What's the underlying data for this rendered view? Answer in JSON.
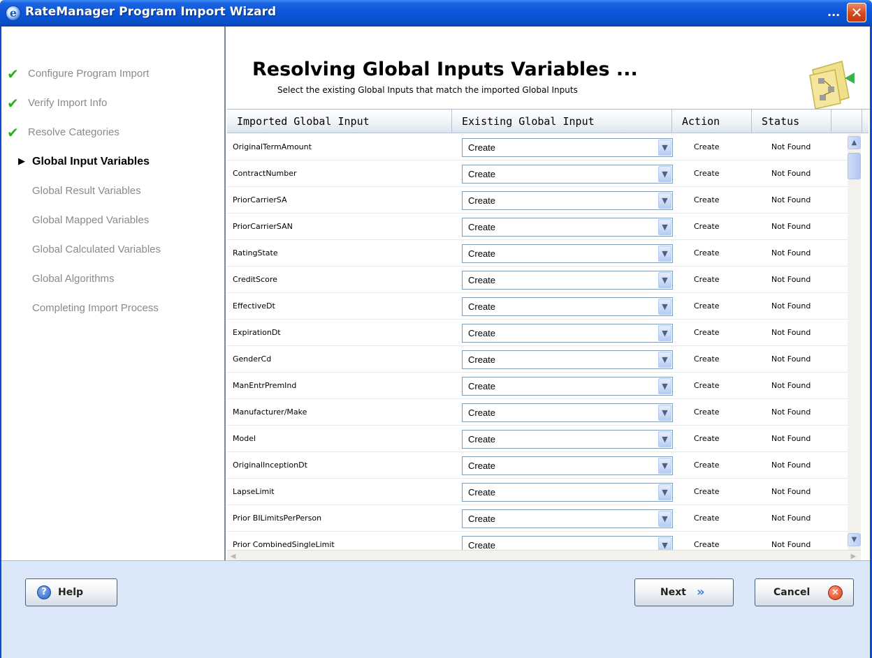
{
  "window": {
    "title": "RateManager Program Import Wizard",
    "ellipsis": "...",
    "close_glyph": "✕"
  },
  "sidebar": {
    "items": [
      {
        "label": "Configure Program Import",
        "state": "done"
      },
      {
        "label": "Verify Import Info",
        "state": "done"
      },
      {
        "label": "Resolve Categories",
        "state": "done"
      },
      {
        "label": "Global Input Variables",
        "state": "current"
      },
      {
        "label": "Global Result Variables",
        "state": "pending"
      },
      {
        "label": "Global Mapped Variables",
        "state": "pending"
      },
      {
        "label": "Global Calculated Variables",
        "state": "pending"
      },
      {
        "label": "Global Algorithms",
        "state": "pending"
      },
      {
        "label": "Completing Import Process",
        "state": "pending"
      }
    ]
  },
  "header": {
    "heading": "Resolving Global Inputs Variables ...",
    "subheading": "Select the existing Global Inputs that match the imported Global Inputs"
  },
  "grid": {
    "columns": [
      "Imported Global Input",
      "Existing Global Input",
      "Action",
      "Status"
    ],
    "rows": [
      {
        "imported": "OriginalTermAmount",
        "existing": "Create",
        "action": "Create",
        "status": "Not Found"
      },
      {
        "imported": "ContractNumber",
        "existing": "Create",
        "action": "Create",
        "status": "Not Found"
      },
      {
        "imported": "PriorCarrierSA",
        "existing": "Create",
        "action": "Create",
        "status": "Not Found"
      },
      {
        "imported": "PriorCarrierSAN",
        "existing": "Create",
        "action": "Create",
        "status": "Not Found"
      },
      {
        "imported": "RatingState",
        "existing": "Create",
        "action": "Create",
        "status": "Not Found"
      },
      {
        "imported": "CreditScore",
        "existing": "Create",
        "action": "Create",
        "status": "Not Found"
      },
      {
        "imported": "EffectiveDt",
        "existing": "Create",
        "action": "Create",
        "status": "Not Found"
      },
      {
        "imported": "ExpirationDt",
        "existing": "Create",
        "action": "Create",
        "status": "Not Found"
      },
      {
        "imported": "GenderCd",
        "existing": "Create",
        "action": "Create",
        "status": "Not Found"
      },
      {
        "imported": "ManEntrPremInd",
        "existing": "Create",
        "action": "Create",
        "status": "Not Found"
      },
      {
        "imported": "Manufacturer/Make",
        "existing": "Create",
        "action": "Create",
        "status": "Not Found"
      },
      {
        "imported": "Model",
        "existing": "Create",
        "action": "Create",
        "status": "Not Found"
      },
      {
        "imported": "OriginalInceptionDt",
        "existing": "Create",
        "action": "Create",
        "status": "Not Found"
      },
      {
        "imported": "LapseLimit",
        "existing": "Create",
        "action": "Create",
        "status": "Not Found"
      },
      {
        "imported": "Prior BILimitsPerPerson",
        "existing": "Create",
        "action": "Create",
        "status": "Not Found"
      },
      {
        "imported": "Prior CombinedSingleLimit",
        "existing": "Create",
        "action": "Create",
        "status": "Not Found"
      }
    ]
  },
  "footer": {
    "help_label": "Help",
    "next_label": "Next",
    "cancel_label": "Cancel"
  },
  "icons": {
    "check": "check-icon",
    "current_arrow": "triangle-right-icon",
    "dropdown": "chevron-down-icon",
    "help": "question-circle-icon",
    "next": "double-chevron-right-icon",
    "cancel": "x-circle-icon"
  },
  "colors": {
    "titlebar": "#0b55d8",
    "footer": "#dbe8fa",
    "check": "#2fae1e",
    "pending_text": "#8a8a8a"
  }
}
